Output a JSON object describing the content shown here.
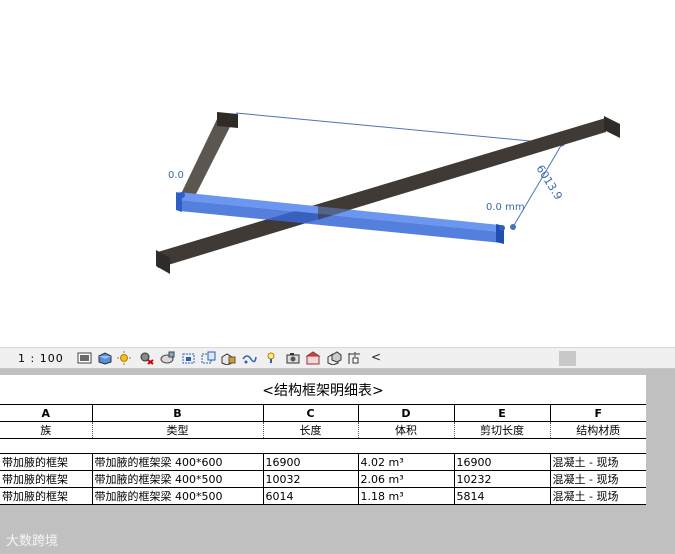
{
  "viewport": {
    "dim_left": "0.0",
    "dim_right": "0.0 mm",
    "dim_length": "6013.9"
  },
  "statusbar": {
    "scale": "1 : 100",
    "icons": [
      "detail-level-icon",
      "visual-style-icon",
      "sun-path-icon",
      "shadows-icon",
      "render-icon",
      "crop-view-icon",
      "show-crop-icon",
      "unlock-3d-icon",
      "temporary-hide-icon",
      "reveal-hidden-icon",
      "temporary-view-icon",
      "analytical-model-icon",
      "highlight-displacement-icon",
      "constraints-icon"
    ],
    "collapse_label": "<"
  },
  "schedule": {
    "title": "<结构框架明细表>",
    "column_letters": [
      "A",
      "B",
      "C",
      "D",
      "E",
      "F"
    ],
    "column_headers": [
      "族",
      "类型",
      "长度",
      "体积",
      "剪切长度",
      "结构材质"
    ],
    "rows": [
      [
        "带加腋的框架",
        "带加腋的框架梁  400*600",
        "16900",
        "4.02 m³",
        "16900",
        "混凝土 - 现场"
      ],
      [
        "带加腋的框架",
        "带加腋的框架梁  400*500",
        "10032",
        "2.06 m³",
        "10232",
        "混凝土 - 现场"
      ],
      [
        "带加腋的框架",
        "带加腋的框架梁  400*500",
        "6014",
        "1.18 m³",
        "5814",
        "混凝土 - 现场"
      ]
    ]
  },
  "watermark": "大数跨境",
  "colors": {
    "beam": "#4a4540",
    "selected": "#3a6fd8",
    "dimension": "#3a6aa8"
  }
}
